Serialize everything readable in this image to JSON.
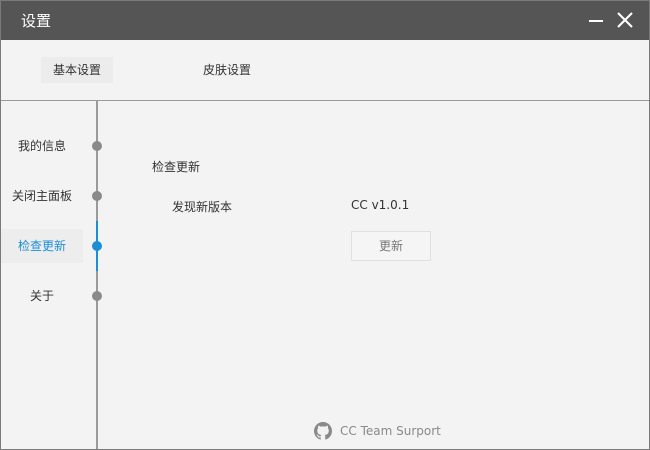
{
  "window": {
    "title": "设置"
  },
  "tabs": [
    {
      "label": "基本设置",
      "active": true
    },
    {
      "label": "皮肤设置",
      "active": false
    }
  ],
  "sidebar": {
    "items": [
      {
        "label": "我的信息",
        "active": false
      },
      {
        "label": "关闭主面板",
        "active": false
      },
      {
        "label": "检查更新",
        "active": true
      },
      {
        "label": "关于",
        "active": false
      }
    ]
  },
  "update": {
    "section_title": "检查更新",
    "found_label": "发现新版本",
    "version": "CC v1.0.1",
    "button_label": "更新"
  },
  "footer": {
    "icon": "github-icon",
    "text": "CC Team Surport"
  },
  "colors": {
    "titlebar": "#555555",
    "accent": "#1a8fd6",
    "background": "#f3f3f3",
    "timeline": "#9a9a9a"
  }
}
